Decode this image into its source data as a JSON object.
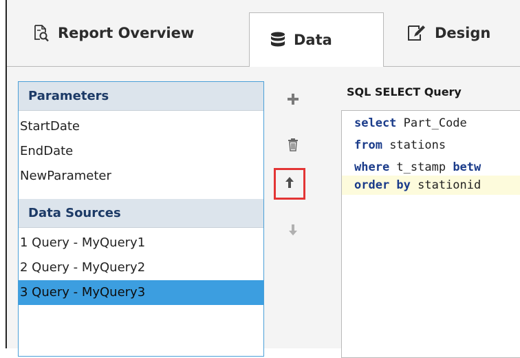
{
  "tabs": [
    {
      "label": "Report Overview",
      "icon": "report-search-icon",
      "active": false
    },
    {
      "label": "Data",
      "icon": "database-icon",
      "active": true
    },
    {
      "label": "Design",
      "icon": "design-edit-icon",
      "active": false
    }
  ],
  "left_panel": {
    "parameters_header": "Parameters",
    "parameters": [
      "StartDate",
      "EndDate",
      "NewParameter"
    ],
    "data_sources_header": "Data Sources",
    "data_sources": [
      "1 Query - MyQuery1",
      "2 Query - MyQuery2",
      "3 Query - MyQuery3"
    ],
    "selected_data_source": "3 Query - MyQuery3"
  },
  "toolbar": {
    "buttons": [
      "add-icon",
      "delete-icon",
      "move-up-icon",
      "move-down-icon"
    ],
    "highlighted": "move-up-icon"
  },
  "sql": {
    "label": "SQL SELECT Query",
    "lines": [
      {
        "kw": "select",
        "rest": " Part_Code"
      },
      {
        "kw": "from",
        "rest": " stations"
      },
      {
        "kw": "where",
        "rest": " t_stamp ",
        "kw2": "betw"
      },
      {
        "kw": "order by",
        "rest": " stationid"
      }
    ]
  },
  "colors": {
    "selection": "#3c9ee0",
    "highlight_border": "#e33535",
    "keyword": "#1a3b8a",
    "section_header_bg": "#dce4ec"
  }
}
